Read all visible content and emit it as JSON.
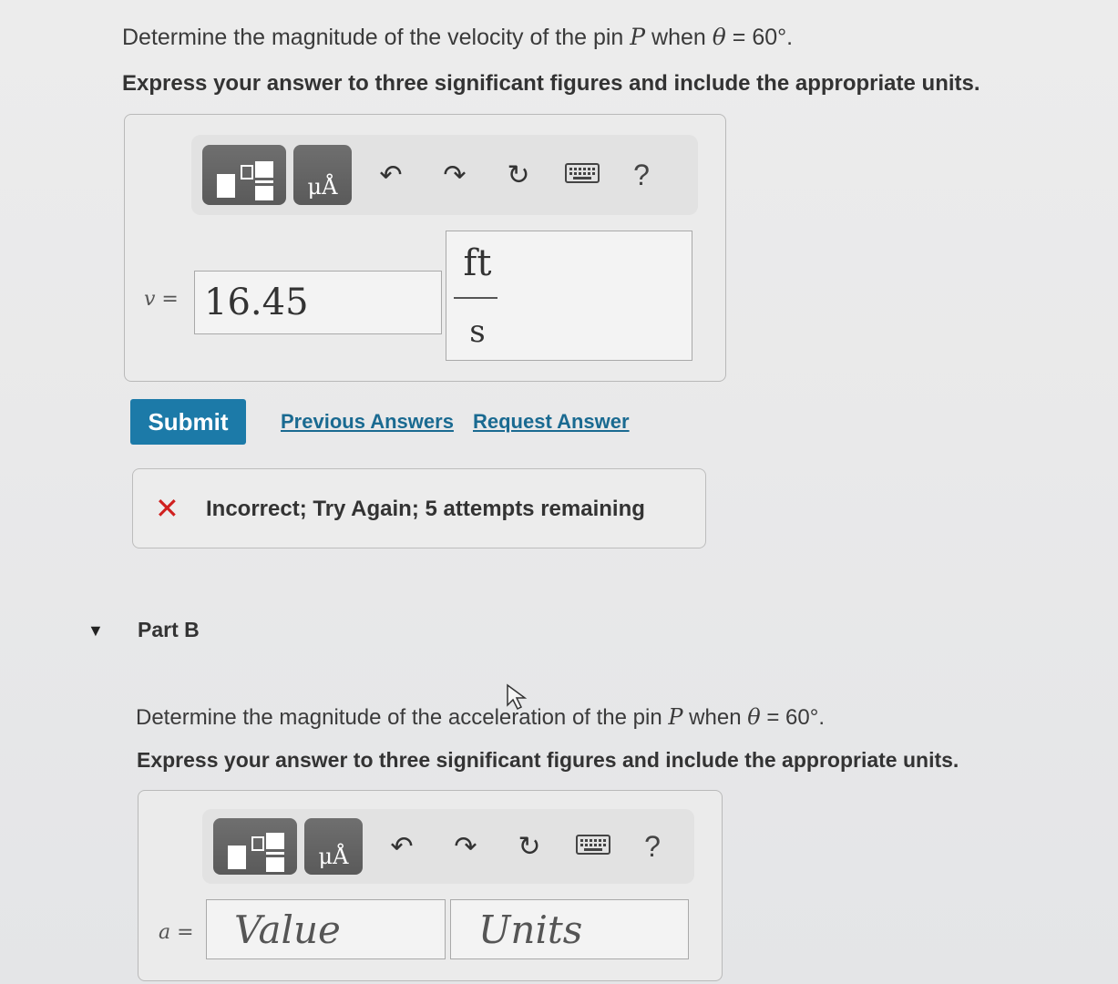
{
  "partA": {
    "question_prefix": "Determine the magnitude of the velocity of the pin ",
    "question_var": "P",
    "question_mid": " when ",
    "question_theta": "θ",
    "question_eq": " = 60°",
    "question_end": ".",
    "instruction": "Express your answer to three significant figures and include the appropriate units.",
    "variable_label": "v =",
    "answer_value": "16.45",
    "units_numerator": "ft",
    "units_denominator": "s",
    "toolbar": {
      "templates_icon": "fraction-templates-icon",
      "units_icon_label": "μÅ",
      "undo_icon": "↶",
      "redo_icon": "↷",
      "reset_icon": "↻",
      "keyboard_icon": "keyboard-icon",
      "help_label": "?"
    },
    "submit_label": "Submit",
    "previous_answers_label": "Previous Answers",
    "request_answer_label": "Request Answer",
    "feedback_icon": "✕",
    "feedback_text": "Incorrect; Try Again; 5 attempts remaining"
  },
  "partB": {
    "collapse_icon": "▼",
    "title": "Part B",
    "question_prefix": "Determine the magnitude of the acceleration of the pin ",
    "question_var": "P",
    "question_mid": " when ",
    "question_theta": "θ",
    "question_eq": " = 60°",
    "question_end": ".",
    "instruction": "Express your answer to three significant figures and include the appropriate units.",
    "variable_label": "a =",
    "value_placeholder": "Value",
    "units_placeholder": "Units",
    "toolbar": {
      "units_icon_label": "μÅ",
      "undo_icon": "↶",
      "redo_icon": "↷",
      "reset_icon": "↻",
      "help_label": "?"
    }
  },
  "colors": {
    "submit_bg": "#1c7aa8",
    "link": "#1a6a91",
    "error": "#d0201f"
  }
}
